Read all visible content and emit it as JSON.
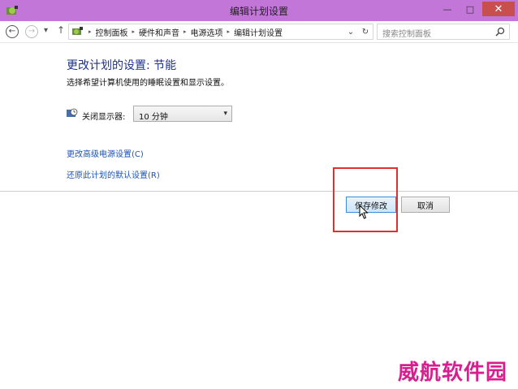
{
  "window": {
    "title": "编辑计划设置",
    "minimize_glyph": "—",
    "maximize_glyph": "□",
    "close_glyph": "✕"
  },
  "nav": {
    "back_glyph": "←",
    "forward_glyph": "→",
    "dropdown_glyph": "▾",
    "up_glyph": "↑",
    "sep_glyph": "▸",
    "breadcrumbs": [
      "控制面板",
      "硬件和声音",
      "电源选项",
      "编辑计划设置"
    ],
    "addr_dropdown_glyph": "⌄",
    "refresh_glyph": "↻",
    "search_placeholder": "搜索控制面板"
  },
  "main": {
    "heading": "更改计划的设置: 节能",
    "subtext": "选择希望计算机使用的睡眠设置和显示设置。",
    "display_off_label": "关闭显示器:",
    "display_off_value": "10 分钟",
    "select_arrow_glyph": "▾",
    "advanced_link": "更改高级电源设置(C)",
    "restore_link": "还原此计划的默认设置(R)"
  },
  "buttons": {
    "save": "保存修改",
    "cancel": "取消"
  },
  "watermark": "威航软件园",
  "colors": {
    "titlebar": "#c276d8",
    "close": "#c7504e",
    "heading": "#1e3287",
    "link": "#1e52b8",
    "highlight": "#e03030",
    "watermark": "#d81f8f"
  }
}
